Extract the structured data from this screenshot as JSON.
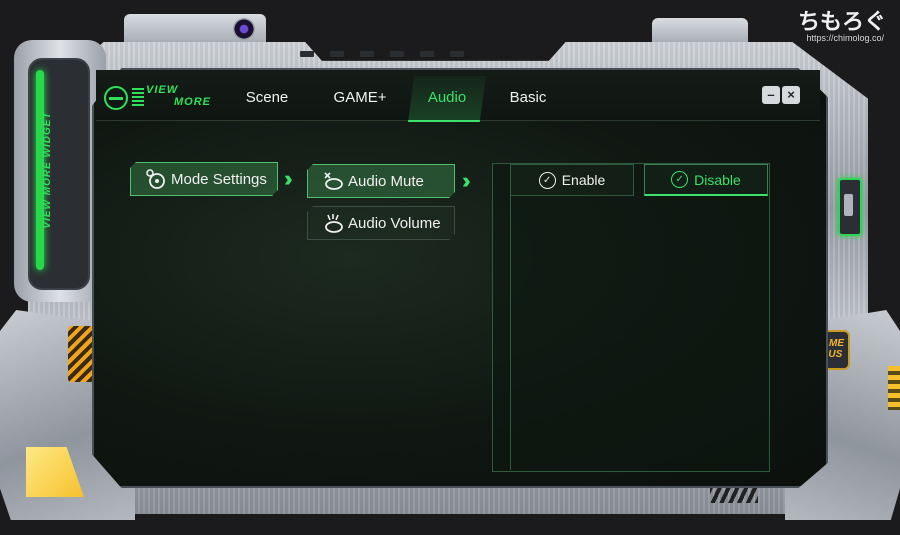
{
  "widget": {
    "side_label": "VIEW MORE WIDGET",
    "logo_line1": "VIEW",
    "logo_line2": "MORE",
    "gameplus_line1": "GAME",
    "gameplus_line2": "PLUS"
  },
  "tabs": [
    {
      "label": "Scene",
      "active": false
    },
    {
      "label": "GAME+",
      "active": false
    },
    {
      "label": "Audio",
      "active": true
    },
    {
      "label": "Basic",
      "active": false
    }
  ],
  "window_controls": {
    "minimize": "–",
    "close": "×"
  },
  "mode_settings": {
    "label": "Mode Settings"
  },
  "audio_options": [
    {
      "label": "Audio Mute",
      "selected": true
    },
    {
      "label": "Audio Volume",
      "selected": false
    }
  ],
  "toggle": {
    "enable_label": "Enable",
    "disable_label": "Disable",
    "selected": "Disable"
  },
  "watermark": {
    "title": "ちもろぐ",
    "url": "https://chimolog.co/"
  },
  "colors": {
    "accent_green": "#3ce06b",
    "accent_yellow": "#f5c02c",
    "screen_bg": "#101712"
  }
}
